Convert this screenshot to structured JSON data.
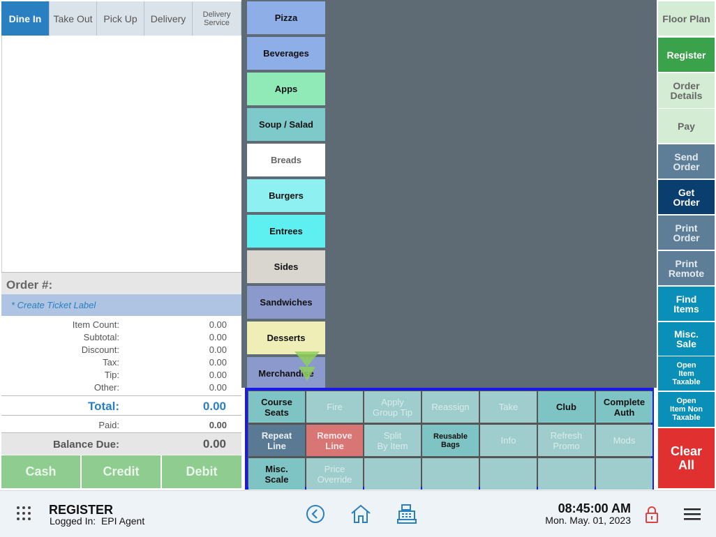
{
  "order_types": [
    {
      "label": "Dine In",
      "active": true
    },
    {
      "label": "Take Out",
      "active": false
    },
    {
      "label": "Pick Up",
      "active": false
    },
    {
      "label": "Delivery",
      "active": false
    },
    {
      "label": "Delivery Service",
      "active": false
    }
  ],
  "order": {
    "order_label": "Order #:",
    "ticket_label": "* Create Ticket Label",
    "summary": [
      {
        "label": "Item Count:",
        "value": "0.00"
      },
      {
        "label": "Subtotal:",
        "value": "0.00"
      },
      {
        "label": "Discount:",
        "value": "0.00"
      },
      {
        "label": "Tax:",
        "value": "0.00"
      },
      {
        "label": "Tip:",
        "value": "0.00"
      },
      {
        "label": "Other:",
        "value": "0.00"
      }
    ],
    "total_label": "Total:",
    "total_value": "0.00",
    "paid_label": "Paid:",
    "paid_value": "0.00",
    "balance_label": "Balance Due:",
    "balance_value": "0.00"
  },
  "payment_buttons": [
    "Cash",
    "Credit",
    "Debit"
  ],
  "categories": [
    {
      "label": "Pizza",
      "color": "#8eaee8"
    },
    {
      "label": "Beverages",
      "color": "#8eaee8"
    },
    {
      "label": "Apps",
      "color": "#90eab8"
    },
    {
      "label": "Soup / Salad",
      "color": "#7ecaca"
    },
    {
      "label": "Breads",
      "color": "#ffffff"
    },
    {
      "label": "Burgers",
      "color": "#8ef0f0"
    },
    {
      "label": "Entrees",
      "color": "#5ef0f0"
    },
    {
      "label": "Sides",
      "color": "#d8d6cf"
    },
    {
      "label": "Sandwiches",
      "color": "#8c99cc"
    },
    {
      "label": "Desserts",
      "color": "#efeeb6"
    },
    {
      "label": "Merchandise",
      "color": "#8c99cc"
    }
  ],
  "function_buttons": [
    [
      "Course\nSeats",
      "Fire",
      "Apply\nGroup Tip",
      "Reassign",
      "Take",
      "Club",
      "Complete\nAuth"
    ],
    [
      "Repeat\nLine",
      "Remove\nLine",
      "Split\nBy Item",
      "Reusable\nBags",
      "Info",
      "Refresh\nPromo",
      "Mods"
    ],
    [
      "Misc.\nScale",
      "Price\nOverride",
      "",
      "",
      "",
      "",
      ""
    ]
  ],
  "function_states": [
    [
      "on",
      "off",
      "off",
      "off",
      "off",
      "on",
      "on"
    ],
    [
      "dark",
      "red",
      "off",
      "on-tiny",
      "off",
      "off",
      "off"
    ],
    [
      "on",
      "off",
      "off",
      "off",
      "off",
      "off",
      "off"
    ]
  ],
  "right_buttons": [
    {
      "label": "Floor Plan",
      "bg": "#d4ecd4",
      "fg": "#666666"
    },
    {
      "label": "Register",
      "bg": "#3aa24a",
      "fg": "#ffffff"
    },
    {
      "label": "Order\nDetails",
      "bg": "#d4ecd4",
      "fg": "#666666"
    },
    {
      "label": "Pay",
      "bg": "#d4ecd4",
      "fg": "#666666"
    },
    {
      "label": "Send\nOrder",
      "bg": "#5e7d97",
      "fg": "#e3ecf3"
    },
    {
      "label": "Get\nOrder",
      "bg": "#0a3e6e",
      "fg": "#ffffff"
    },
    {
      "label": "Print\nOrder",
      "bg": "#5e7d97",
      "fg": "#e3ecf3"
    },
    {
      "label": "Print\nRemote",
      "bg": "#5e7d97",
      "fg": "#e3ecf3"
    },
    {
      "label": "Find\nItems",
      "bg": "#0a8fb8",
      "fg": "#ffffff"
    },
    {
      "label": "Misc.\nSale",
      "bg": "#0a8fb8",
      "fg": "#ffffff"
    },
    {
      "label": "Open\nItem\nTaxable",
      "bg": "#0a8fb8",
      "fg": "#ffffff"
    },
    {
      "label": "Open\nItem Non\nTaxable",
      "bg": "#0a8fb8",
      "fg": "#ffffff"
    },
    {
      "label": "Clear\nAll",
      "bg": "#e03030",
      "fg": "#ffffff"
    }
  ],
  "bottom_bar": {
    "title": "REGISTER",
    "logged_in": "Logged In:  EPI Agent",
    "time": "08:45:00 AM",
    "date": "Mon. May. 01, 2023",
    "icons": [
      "app-grid-icon",
      "back-icon",
      "home-icon",
      "cash-register-icon",
      "lock-icon",
      "menu-icon"
    ]
  }
}
